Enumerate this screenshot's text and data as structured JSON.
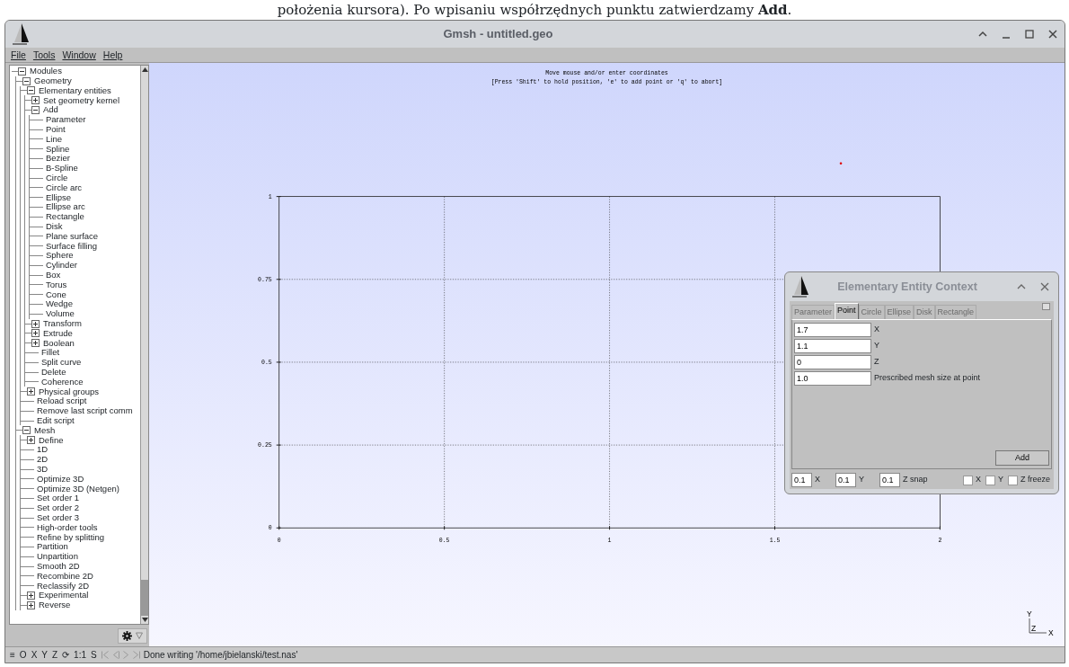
{
  "document_caption": "położenia kursora). Po wpisaniu współrzędnych punktu zatwierdzamy **Add**.",
  "window": {
    "title": "Gmsh - untitled.geo"
  },
  "menu": [
    "File",
    "Tools",
    "Window",
    "Help"
  ],
  "tree": [
    {
      "label": "Modules",
      "expanded": true,
      "children": [
        {
          "label": "Geometry",
          "expanded": true,
          "children": [
            {
              "label": "Elementary entities",
              "expanded": true,
              "children": [
                {
                  "label": "Set geometry kernel",
                  "expanded": false
                },
                {
                  "label": "Add",
                  "expanded": true,
                  "children": [
                    {
                      "label": "Parameter"
                    },
                    {
                      "label": "Point"
                    },
                    {
                      "label": "Line"
                    },
                    {
                      "label": "Spline"
                    },
                    {
                      "label": "Bezier"
                    },
                    {
                      "label": "B-Spline"
                    },
                    {
                      "label": "Circle"
                    },
                    {
                      "label": "Circle arc"
                    },
                    {
                      "label": "Ellipse"
                    },
                    {
                      "label": "Ellipse arc"
                    },
                    {
                      "label": "Rectangle"
                    },
                    {
                      "label": "Disk"
                    },
                    {
                      "label": "Plane surface"
                    },
                    {
                      "label": "Surface filling"
                    },
                    {
                      "label": "Sphere"
                    },
                    {
                      "label": "Cylinder"
                    },
                    {
                      "label": "Box"
                    },
                    {
                      "label": "Torus"
                    },
                    {
                      "label": "Cone"
                    },
                    {
                      "label": "Wedge"
                    },
                    {
                      "label": "Volume"
                    }
                  ]
                },
                {
                  "label": "Transform",
                  "expanded": false
                },
                {
                  "label": "Extrude",
                  "expanded": false
                },
                {
                  "label": "Boolean",
                  "expanded": false
                },
                {
                  "label": "Fillet"
                },
                {
                  "label": "Split curve"
                },
                {
                  "label": "Delete"
                },
                {
                  "label": "Coherence"
                }
              ]
            },
            {
              "label": "Physical groups",
              "expanded": false
            },
            {
              "label": "Reload script"
            },
            {
              "label": "Remove last script comm"
            },
            {
              "label": "Edit script"
            }
          ]
        },
        {
          "label": "Mesh",
          "expanded": true,
          "children": [
            {
              "label": "Define",
              "expanded": false
            },
            {
              "label": "1D"
            },
            {
              "label": "2D"
            },
            {
              "label": "3D"
            },
            {
              "label": "Optimize 3D"
            },
            {
              "label": "Optimize 3D (Netgen)"
            },
            {
              "label": "Set order 1"
            },
            {
              "label": "Set order 2"
            },
            {
              "label": "Set order 3"
            },
            {
              "label": "High-order tools"
            },
            {
              "label": "Refine by splitting"
            },
            {
              "label": "Partition"
            },
            {
              "label": "Unpartition"
            },
            {
              "label": "Smooth 2D"
            },
            {
              "label": "Recombine 2D"
            },
            {
              "label": "Reclassify 2D"
            },
            {
              "label": "Experimental",
              "expanded": false
            },
            {
              "label": "Reverse",
              "expanded": false
            }
          ]
        }
      ]
    }
  ],
  "canvas": {
    "messages": [
      "Move mouse and/or enter coordinates",
      "[Press 'Shift' to hold position, 'e' to add point or 'q' to abort]"
    ],
    "x_ticks": [
      "0",
      "0.5",
      "1",
      "1.5",
      "2"
    ],
    "y_ticks": [
      "1",
      "0.75",
      "0.5",
      "0.25",
      "0"
    ],
    "axes_labels": [
      "Y",
      "Z",
      "X"
    ]
  },
  "dialog": {
    "title": "Elementary Entity Context",
    "tabs": [
      {
        "label": "Parameter",
        "selected": false,
        "disabled": true
      },
      {
        "label": "Point",
        "selected": true,
        "disabled": false
      },
      {
        "label": "Circle",
        "selected": false,
        "disabled": true
      },
      {
        "label": "Ellipse",
        "selected": false,
        "disabled": true
      },
      {
        "label": "Disk",
        "selected": false,
        "disabled": true
      },
      {
        "label": "Rectangle",
        "selected": false,
        "disabled": true
      }
    ],
    "fields": [
      {
        "value": "1.7",
        "label": "X"
      },
      {
        "value": "1.1",
        "label": "Y"
      },
      {
        "value": "0",
        "label": "Z"
      },
      {
        "value": "1.0",
        "label": "Prescribed mesh size at point"
      }
    ],
    "add_button": "Add",
    "snap": [
      {
        "value": "0.1",
        "label": "X"
      },
      {
        "value": "0.1",
        "label": "Y"
      },
      {
        "value": "0.1",
        "label": "Z snap"
      }
    ],
    "freeze": [
      {
        "label": "X",
        "checked": false
      },
      {
        "label": "Y",
        "checked": false
      },
      {
        "label": "Z freeze",
        "checked": false
      }
    ]
  },
  "status_bar": {
    "buttons": [
      "O",
      "X",
      "Y",
      "Z",
      "1:1",
      "S"
    ],
    "menu_glyph": "≡",
    "rotate_glyph": "⟳",
    "message": "Done writing '/home/jbielanski/test.nas'"
  }
}
